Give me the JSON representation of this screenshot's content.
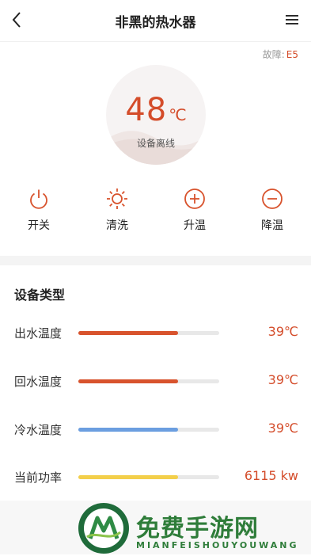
{
  "header": {
    "title": "非黑的热水器",
    "back_icon": "chevron-left-icon",
    "menu_icon": "hamburger-menu-icon"
  },
  "fault": {
    "label": "故障:",
    "code": "E5"
  },
  "temperature": {
    "value": "48",
    "unit": "℃",
    "status": "设备离线"
  },
  "controls": [
    {
      "label": "开关",
      "icon": "power-icon"
    },
    {
      "label": "清洗",
      "icon": "sun-icon"
    },
    {
      "label": "升温",
      "icon": "plus-circle-icon"
    },
    {
      "label": "降温",
      "icon": "minus-circle-icon"
    }
  ],
  "device_section": {
    "title": "设备类型",
    "rows": [
      {
        "label": "出水温度",
        "value": "39℃",
        "level": 0.71,
        "color": "#d8532d"
      },
      {
        "label": "回水温度",
        "value": "39℃",
        "level": 0.71,
        "color": "#d8532d"
      },
      {
        "label": "冷水温度",
        "value": "39℃",
        "level": 0.71,
        "color": "#6b9ee0"
      },
      {
        "label": "当前功率",
        "value": "6115 kw",
        "level": 0.71,
        "color": "#f3cf4a"
      }
    ]
  },
  "watermark": {
    "brand": "免费手游网",
    "sub": "MIANFEISHOUYOUWANG"
  },
  "colors": {
    "accent": "#d44c2a"
  }
}
